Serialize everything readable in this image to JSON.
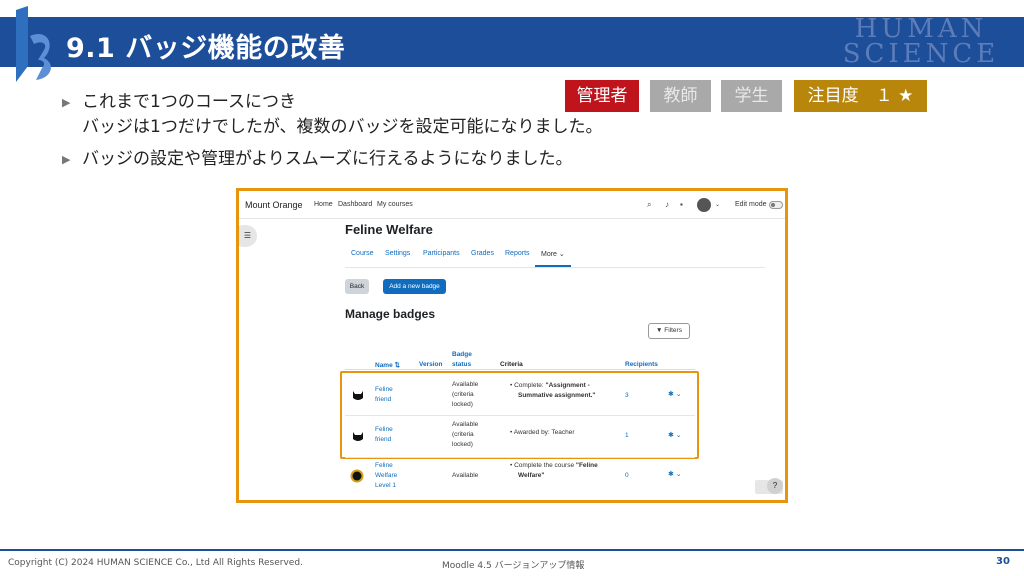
{
  "slide": {
    "title": "9.1 バッジ機能の改善",
    "brand_line1": "HUMAN",
    "brand_line2": "SCIENCE",
    "bullets": [
      {
        "line1": "これまで1つのコースにつき",
        "line2": "バッジは1つだけでしたが、複数のバッジを設定可能になりました。"
      },
      {
        "line1": "バッジの設定や管理がよりスムーズに行えるようになりました。"
      }
    ],
    "tags": {
      "admin": "管理者",
      "teacher": "教師",
      "student": "学生",
      "attention": "注目度　１ ★"
    }
  },
  "moodle": {
    "site_name": "Mount Orange",
    "nav": [
      "Home",
      "Dashboard",
      "My courses"
    ],
    "edit_mode": "Edit mode",
    "course_title": "Feline Welfare",
    "tabs": [
      "Course",
      "Settings",
      "Participants",
      "Grades",
      "Reports",
      "More ⌄"
    ],
    "back_label": "Back",
    "add_badge_label": "Add a new badge",
    "manage_title": "Manage badges",
    "filters_label": "Filters",
    "columns": {
      "name": "Name ⇅",
      "version": "Version",
      "status_1": "Badge",
      "status_2": "status",
      "criteria": "Criteria",
      "recipients": "Recipients"
    },
    "rows": [
      {
        "name1": "Feline",
        "name2": "friend",
        "name3": "",
        "status1": "Available",
        "status2": "(criteria",
        "status3": "locked)",
        "crit1": "• Complete: ",
        "crit1b": "\"Assignment -",
        "crit2": "Summative assignment.\"",
        "recipients": "3"
      },
      {
        "name1": "Feline",
        "name2": "friend",
        "name3": "",
        "status1": "Available",
        "status2": "(criteria",
        "status3": "locked)",
        "crit1": "• Awarded by: Teacher",
        "crit1b": "",
        "crit2": "",
        "recipients": "1"
      },
      {
        "name1": "Feline",
        "name2": "Welfare",
        "name3": "Level 1",
        "status1": "Available",
        "status2": "",
        "status3": "",
        "crit1": "• Complete the course ",
        "crit1b": "\"Feline",
        "crit2": "Welfare\"",
        "recipients": "0"
      }
    ],
    "help_label": "?"
  },
  "footer": {
    "copyright": "Copyright (C) 2024 HUMAN SCIENCE Co., Ltd All Rights Reserved.",
    "subtitle": "Moodle 4.5 バージョンアップ情報",
    "page": "30"
  },
  "colors": {
    "header": "#1d4e9a",
    "admin_tag": "#c0141d",
    "inactive_tag": "#a9a9a9",
    "attention_tag": "#b8860b",
    "highlight": "#e8940f",
    "moodle_blue": "#0f6cbf"
  }
}
